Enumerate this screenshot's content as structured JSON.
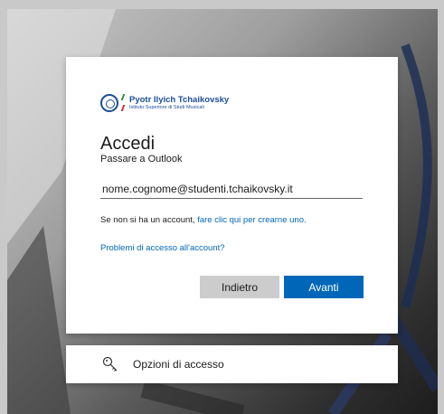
{
  "logo": {
    "name": "Pyotr Ilyich Tchaikovsky",
    "subtitle": "Istituto Superiore di Studi Musicali"
  },
  "signin": {
    "title": "Accedi",
    "subtitle": "Passare a Outlook",
    "email_value": "nome.cognome@studenti.tchaikovsky.it",
    "no_account_text": "Se non si ha un account, ",
    "create_link": "fare clic qui per crearne uno.",
    "problem_link": "Problemi di accesso all'account?",
    "back_button": "Indietro",
    "next_button": "Avanti"
  },
  "options": {
    "label": "Opzioni di accesso",
    "icon": "key-icon"
  },
  "colors": {
    "accent": "#0067b8",
    "logo_blue": "#1b4f9a"
  }
}
